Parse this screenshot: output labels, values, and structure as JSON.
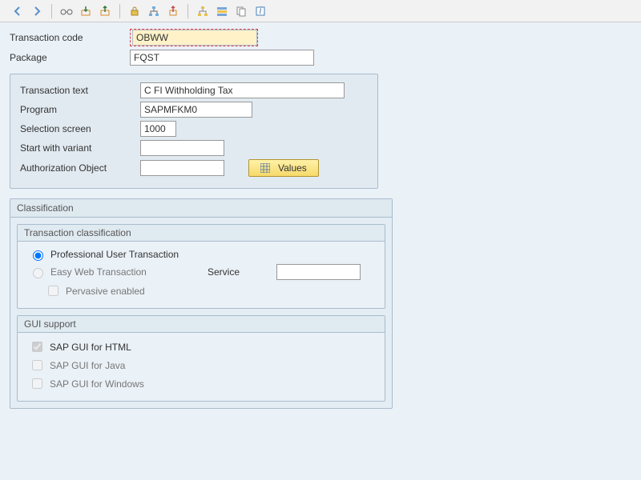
{
  "toolbar": {
    "icons": [
      "back",
      "forward",
      "save",
      "import",
      "export",
      "generate",
      "distribute",
      "delete",
      "hierarchy",
      "layout",
      "copy",
      "info"
    ]
  },
  "header": {
    "transaction_code_label": "Transaction code",
    "transaction_code_value": "OBWW",
    "package_label": "Package",
    "package_value": "FQST"
  },
  "general": {
    "transaction_text_label": "Transaction text",
    "transaction_text_value": "C FI Withholding Tax",
    "program_label": "Program",
    "program_value": "SAPMFKM0",
    "selection_screen_label": "Selection screen",
    "selection_screen_value": "1000",
    "start_variant_label": "Start with variant",
    "start_variant_value": "",
    "auth_object_label": "Authorization Object",
    "auth_object_value": "",
    "values_button": "Values"
  },
  "classification_title": "Classification",
  "txnclass": {
    "title": "Transaction classification",
    "opt_pro": "Professional User Transaction",
    "opt_web": "Easy Web Transaction",
    "service_label": "Service",
    "service_value": "",
    "pervasive": "Pervasive enabled"
  },
  "gui": {
    "title": "GUI support",
    "html": "SAP GUI for HTML",
    "java": "SAP GUI for Java",
    "windows": "SAP GUI for Windows"
  }
}
